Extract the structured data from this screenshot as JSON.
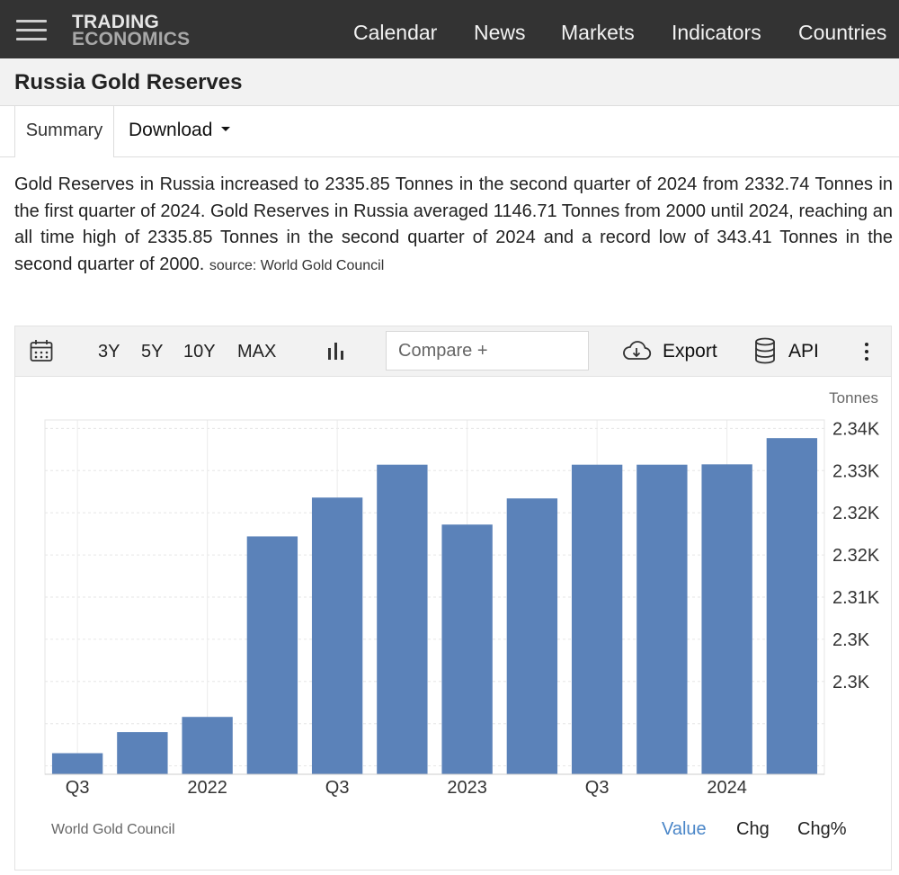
{
  "header": {
    "logo_line1": "TRADING",
    "logo_line2": "ECONOMICS",
    "nav": [
      "Calendar",
      "News",
      "Markets",
      "Indicators",
      "Countries"
    ]
  },
  "page": {
    "title": "Russia Gold Reserves"
  },
  "tabs": {
    "summary": "Summary",
    "download": "Download"
  },
  "description": {
    "text": "Gold Reserves in Russia increased to 2335.85 Tonnes in the second quarter of 2024 from 2332.74 Tonnes in the first quarter of 2024. Gold Reserves in Russia averaged 1146.71 Tonnes from 2000 until 2024, reaching an all time high of 2335.85 Tonnes in the second quarter of 2024 and a record low of 343.41 Tonnes in the second quarter of 2000.",
    "source": "source: World Gold Council"
  },
  "toolbar": {
    "ranges": [
      "3Y",
      "5Y",
      "10Y",
      "MAX"
    ],
    "compare_placeholder": "Compare +",
    "export_label": "Export",
    "api_label": "API"
  },
  "chart_footer": {
    "source": "World Gold Council",
    "value": "Value",
    "chg": "Chg",
    "chg_pct": "Chg%"
  },
  "colors": {
    "bar": "#5b82b9",
    "active_link": "#4a86c8",
    "topbar": "#333333"
  },
  "chart_data": {
    "type": "bar",
    "unit": "Tonnes",
    "x": [
      "2021 Q3",
      "2021 Q4",
      "2022 Q1",
      "2022 Q2",
      "2022 Q3",
      "2022 Q4",
      "2023 Q1",
      "2023 Q2",
      "2023 Q3",
      "2023 Q4",
      "2024 Q1",
      "2024 Q2"
    ],
    "x_tick_labels": [
      "Q3",
      "",
      "2022",
      "",
      "Q3",
      "",
      "2023",
      "",
      "Q3",
      "",
      "2024",
      ""
    ],
    "values": [
      2298.5,
      2301.0,
      2302.8,
      2324.2,
      2328.8,
      2332.7,
      2325.6,
      2328.7,
      2332.7,
      2332.7,
      2332.74,
      2335.85
    ],
    "ylim": [
      2296.0,
      2338.0
    ],
    "y_ticks": [
      2297,
      2302,
      2307,
      2312,
      2317,
      2322,
      2327,
      2332,
      2337
    ],
    "y_tick_labels": [
      "2.3K",
      "2.3K",
      "2.31K",
      "2.32K",
      "2.32K",
      "2.33K",
      "2.34K"
    ],
    "grid": true
  }
}
